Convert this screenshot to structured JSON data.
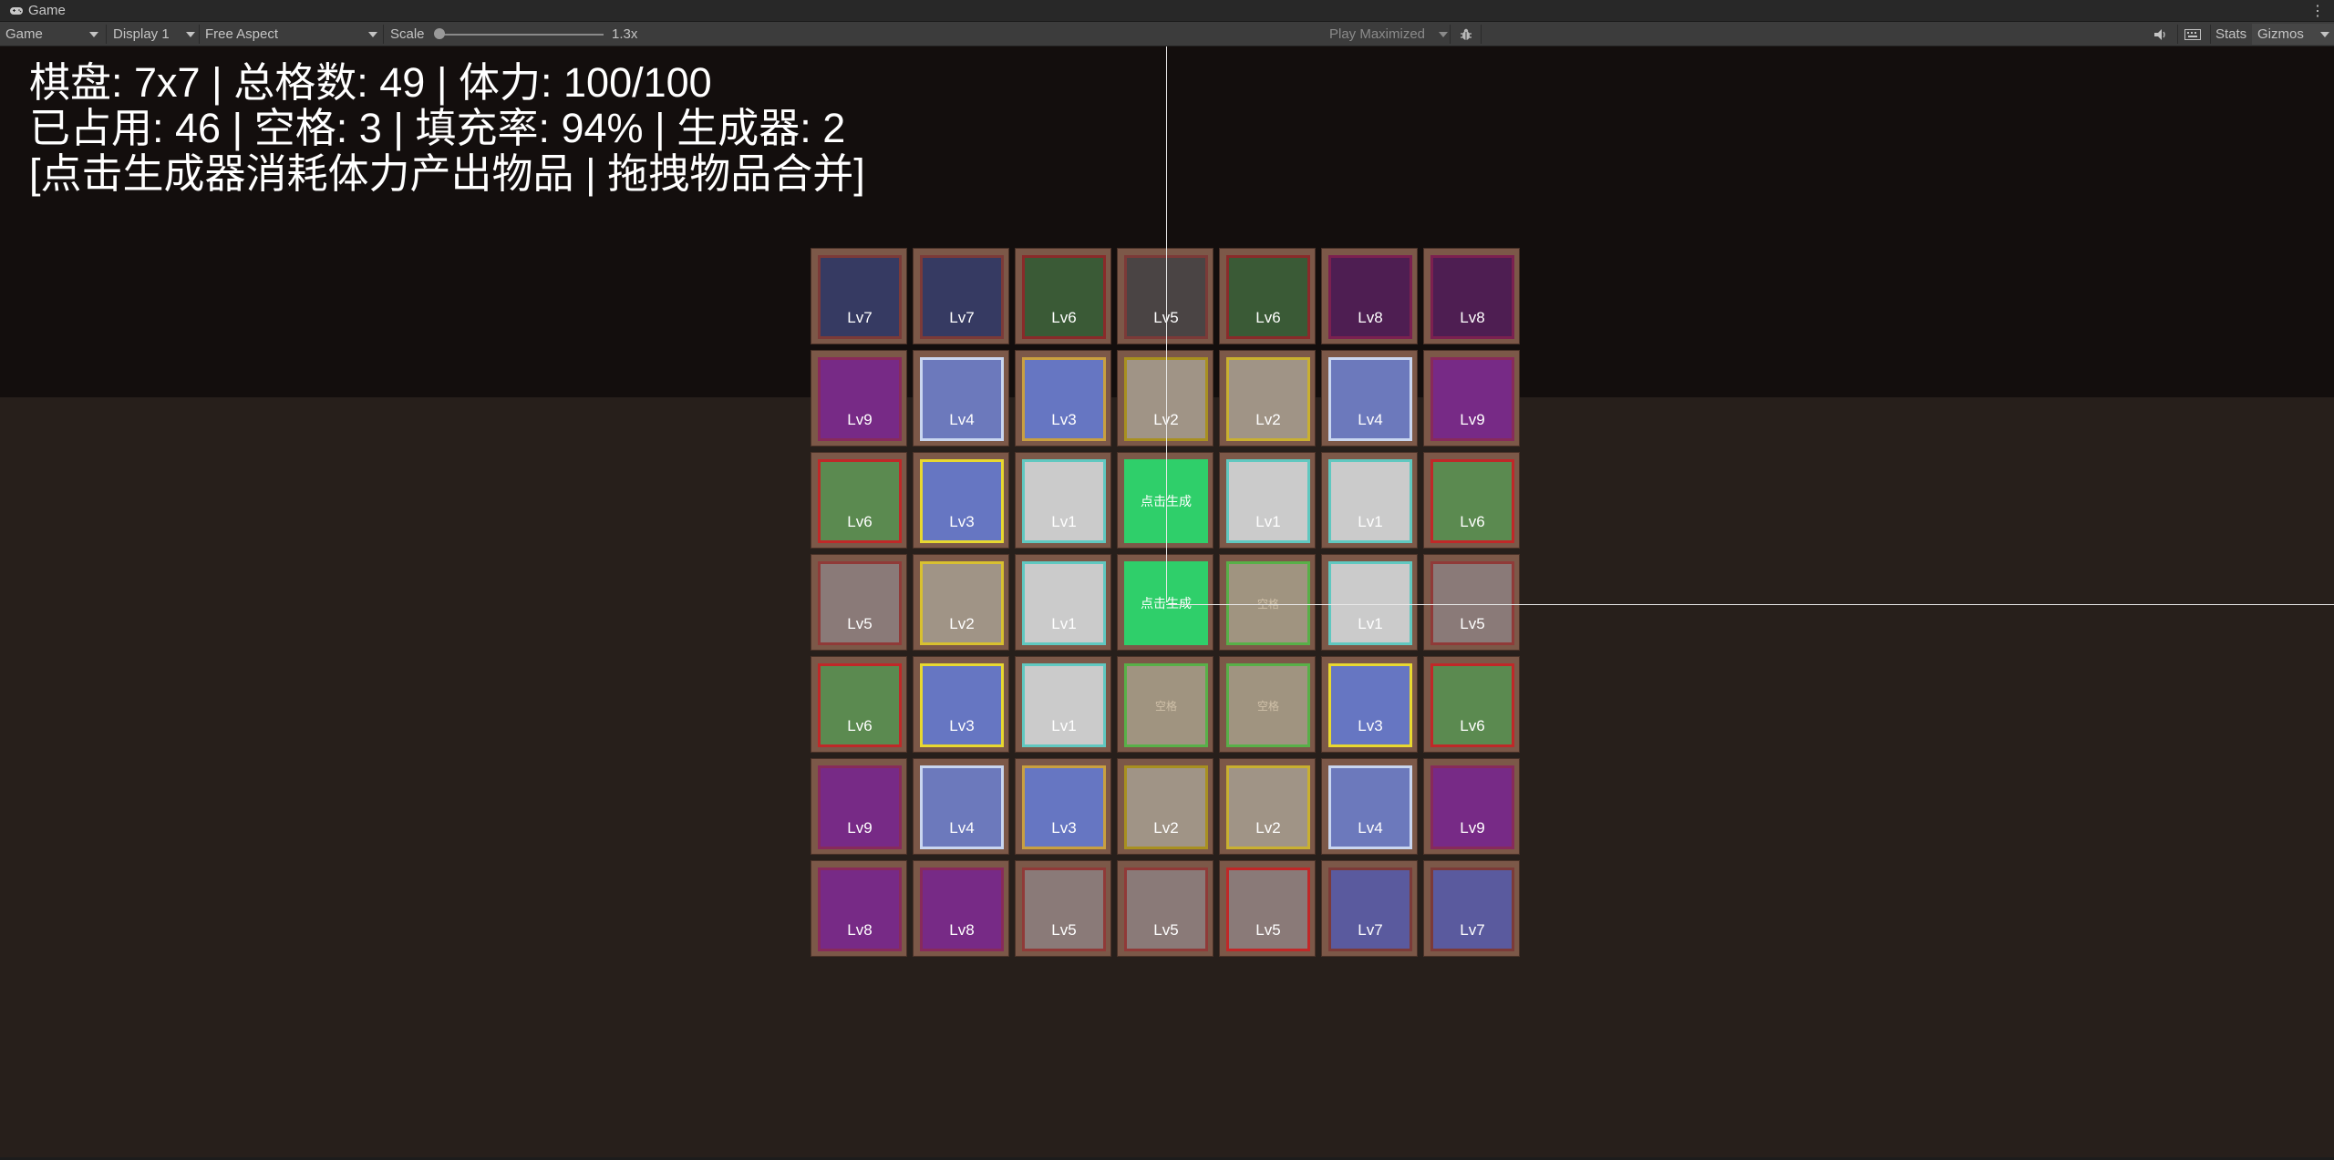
{
  "window": {
    "tab_title": "Game",
    "menu_glyph": "⋮"
  },
  "toolbar": {
    "view_mode": "Game",
    "display": "Display 1",
    "aspect": "Free Aspect",
    "scale_label": "Scale",
    "scale_value": "1.3x",
    "play_mode": "Play Maximized",
    "stats_label": "Stats",
    "gizmos_label": "Gizmos"
  },
  "hud": {
    "line1": "棋盘: 7x7 | 总格数: 49 | 体力: 100/100",
    "line2": "已占用: 46 | 空格: 3 | 填充率: 94% | 生成器: 2",
    "line3": "[点击生成器消耗体力产出物品 | 拖拽物品合并]"
  },
  "board": {
    "rows": 7,
    "cols": 7,
    "generator_label": "点击生成",
    "empty_label": "空格",
    "cells": [
      [
        {
          "t": "item",
          "lv": "Lv7",
          "fill": "#363a62",
          "border": "#7c3a38"
        },
        {
          "t": "item",
          "lv": "Lv7",
          "fill": "#363a62",
          "border": "#7c3a38"
        },
        {
          "t": "item",
          "lv": "Lv6",
          "fill": "#3a5a36",
          "border": "#8a2a2a"
        },
        {
          "t": "item",
          "lv": "Lv5",
          "fill": "#4a4444",
          "border": "#7c3a38"
        },
        {
          "t": "item",
          "lv": "Lv6",
          "fill": "#3a5a36",
          "border": "#8a2a2a"
        },
        {
          "t": "item",
          "lv": "Lv8",
          "fill": "#4e1e52",
          "border": "#7c2050"
        },
        {
          "t": "item",
          "lv": "Lv8",
          "fill": "#4e1e52",
          "border": "#7c2050"
        }
      ],
      [
        {
          "t": "item",
          "lv": "Lv9",
          "fill": "#772a86",
          "border": "#882a5a"
        },
        {
          "t": "item",
          "lv": "Lv4",
          "fill": "#6c79bc",
          "border": "#c9d6f0"
        },
        {
          "t": "item",
          "lv": "Lv3",
          "fill": "#6676c2",
          "border": "#c9a040"
        },
        {
          "t": "item",
          "lv": "Lv2",
          "fill": "#a09486",
          "border": "#a89020"
        },
        {
          "t": "item",
          "lv": "Lv2",
          "fill": "#a09486",
          "border": "#c9b030"
        },
        {
          "t": "item",
          "lv": "Lv4",
          "fill": "#6c79bc",
          "border": "#c9d6f0"
        },
        {
          "t": "item",
          "lv": "Lv9",
          "fill": "#772a86",
          "border": "#882a5a"
        }
      ],
      [
        {
          "t": "item",
          "lv": "Lv6",
          "fill": "#5b8a50",
          "border": "#c02828"
        },
        {
          "t": "item",
          "lv": "Lv3",
          "fill": "#6676c2",
          "border": "#e8d830"
        },
        {
          "t": "item",
          "lv": "Lv1",
          "fill": "#cbcbcb",
          "border": "#60c8c0"
        },
        {
          "t": "gen",
          "fill": "#2fcf6a",
          "border": "#2fcf6a"
        },
        {
          "t": "item",
          "lv": "Lv1",
          "fill": "#cbcbcb",
          "border": "#60c8c0"
        },
        {
          "t": "item",
          "lv": "Lv1",
          "fill": "#cbcbcb",
          "border": "#60c8c0"
        },
        {
          "t": "item",
          "lv": "Lv6",
          "fill": "#5b8a50",
          "border": "#c02828"
        }
      ],
      [
        {
          "t": "item",
          "lv": "Lv5",
          "fill": "#8a7a78",
          "border": "#903a38"
        },
        {
          "t": "item",
          "lv": "Lv2",
          "fill": "#a09486",
          "border": "#d8c030"
        },
        {
          "t": "item",
          "lv": "Lv1",
          "fill": "#cbcbcb",
          "border": "#60c8c0"
        },
        {
          "t": "gen",
          "fill": "#2fcf6a",
          "border": "#2fcf6a"
        },
        {
          "t": "empty",
          "fill": "#a09480",
          "border": "#58b048"
        },
        {
          "t": "item",
          "lv": "Lv1",
          "fill": "#cbcbcb",
          "border": "#60c8c0"
        },
        {
          "t": "item",
          "lv": "Lv5",
          "fill": "#8a7a78",
          "border": "#903a38"
        }
      ],
      [
        {
          "t": "item",
          "lv": "Lv6",
          "fill": "#5b8a50",
          "border": "#c02828"
        },
        {
          "t": "item",
          "lv": "Lv3",
          "fill": "#6676c2",
          "border": "#e8d830"
        },
        {
          "t": "item",
          "lv": "Lv1",
          "fill": "#cbcbcb",
          "border": "#60c8c0"
        },
        {
          "t": "empty",
          "fill": "#a09480",
          "border": "#58b048"
        },
        {
          "t": "empty",
          "fill": "#a09480",
          "border": "#58b048"
        },
        {
          "t": "item",
          "lv": "Lv3",
          "fill": "#6676c2",
          "border": "#e8d830"
        },
        {
          "t": "item",
          "lv": "Lv6",
          "fill": "#5b8a50",
          "border": "#c02828"
        }
      ],
      [
        {
          "t": "item",
          "lv": "Lv9",
          "fill": "#772a86",
          "border": "#882a5a"
        },
        {
          "t": "item",
          "lv": "Lv4",
          "fill": "#6c79bc",
          "border": "#c9d6f0"
        },
        {
          "t": "item",
          "lv": "Lv3",
          "fill": "#6676c2",
          "border": "#c9a040"
        },
        {
          "t": "item",
          "lv": "Lv2",
          "fill": "#a09486",
          "border": "#a89020"
        },
        {
          "t": "item",
          "lv": "Lv2",
          "fill": "#a09486",
          "border": "#c9b030"
        },
        {
          "t": "item",
          "lv": "Lv4",
          "fill": "#6c79bc",
          "border": "#c9d6f0"
        },
        {
          "t": "item",
          "lv": "Lv9",
          "fill": "#772a86",
          "border": "#882a5a"
        }
      ],
      [
        {
          "t": "item",
          "lv": "Lv8",
          "fill": "#772a86",
          "border": "#882a5a"
        },
        {
          "t": "item",
          "lv": "Lv8",
          "fill": "#772a86",
          "border": "#882a5a"
        },
        {
          "t": "item",
          "lv": "Lv5",
          "fill": "#8a7a78",
          "border": "#903a38"
        },
        {
          "t": "item",
          "lv": "Lv5",
          "fill": "#8a7a78",
          "border": "#903a38"
        },
        {
          "t": "item",
          "lv": "Lv5",
          "fill": "#8a7a78",
          "border": "#c02828"
        },
        {
          "t": "item",
          "lv": "Lv7",
          "fill": "#5a5a9e",
          "border": "#7c3a38"
        },
        {
          "t": "item",
          "lv": "Lv7",
          "fill": "#5a5a9e",
          "border": "#7c3a38"
        }
      ]
    ]
  }
}
